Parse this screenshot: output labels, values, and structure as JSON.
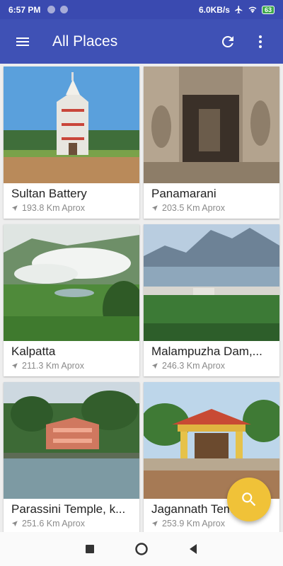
{
  "status_bar": {
    "time": "6:57 PM",
    "network_speed": "6.0KB/s",
    "battery": "63"
  },
  "app_bar": {
    "title": "All Places",
    "icons": [
      "menu-icon",
      "refresh-icon",
      "more-vert-icon"
    ]
  },
  "places": [
    {
      "name": "Sultan Battery",
      "distance": "193.8 Km Aprox"
    },
    {
      "name": "Panamarani",
      "distance": "203.5 Km Aprox"
    },
    {
      "name": "Kalpatta",
      "distance": "211.3 Km Aprox"
    },
    {
      "name": "Malampuzha Dam,...",
      "distance": "246.3 Km Aprox"
    },
    {
      "name": "Parassini Temple, k...",
      "distance": "251.6 Km Aprox"
    },
    {
      "name": "Jagannath Temple",
      "distance": "253.9 Km Aprox"
    }
  ],
  "fab": {
    "icon": "search-icon",
    "color": "#f0c238"
  },
  "colors": {
    "primary": "#3f51b5",
    "status_bar": "#3a4ab0"
  }
}
